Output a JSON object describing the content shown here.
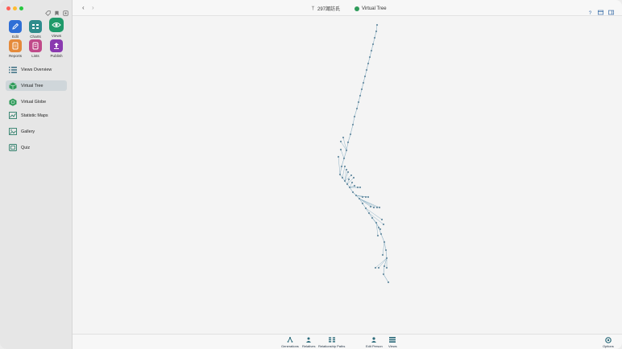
{
  "sidebar": {
    "tiles": [
      {
        "label": "Edit",
        "color": "#2f6fd6",
        "icon": "pencil-icon"
      },
      {
        "label": "Charts",
        "color": "#2f8c8c",
        "icon": "charts-icon"
      },
      {
        "label": "Views",
        "color": "#1f9a6a",
        "icon": "eye-icon",
        "selected": true
      },
      {
        "label": "Reports",
        "color": "#e58a3a",
        "icon": "reports-icon"
      },
      {
        "label": "Lists",
        "color": "#c04a8a",
        "icon": "lists-icon"
      },
      {
        "label": "Publish",
        "color": "#8a3ab0",
        "icon": "publish-icon"
      }
    ],
    "nav": [
      {
        "label": "Views Overview",
        "icon": "list-icon"
      },
      {
        "label": "Virtual Tree",
        "icon": "tree-cube-icon",
        "active": true
      },
      {
        "label": "Virtual Globe",
        "icon": "globe-icon"
      },
      {
        "label": "Statistic Maps",
        "icon": "map-chart-icon"
      },
      {
        "label": "Gallery",
        "icon": "gallery-icon"
      },
      {
        "label": "Quiz",
        "icon": "quiz-icon"
      }
    ]
  },
  "header": {
    "person": "297諏訪氏",
    "view_title": "Virtual Tree"
  },
  "bottom": {
    "items": [
      {
        "label": "Generations",
        "icon": "generations-icon"
      },
      {
        "label": "Relatives",
        "icon": "relatives-icon"
      },
      {
        "label": "Relationship Paths",
        "icon": "relationship-paths-icon"
      },
      {
        "label": "Edit Person",
        "icon": "edit-person-icon"
      },
      {
        "label": "Views",
        "icon": "views-icon"
      },
      {
        "label": "Options",
        "icon": "options-icon"
      }
    ]
  },
  "colors": {
    "accent": "#2f9b5a",
    "tree_node": "#6a8fa3",
    "tree_line": "#8fb3c6"
  }
}
